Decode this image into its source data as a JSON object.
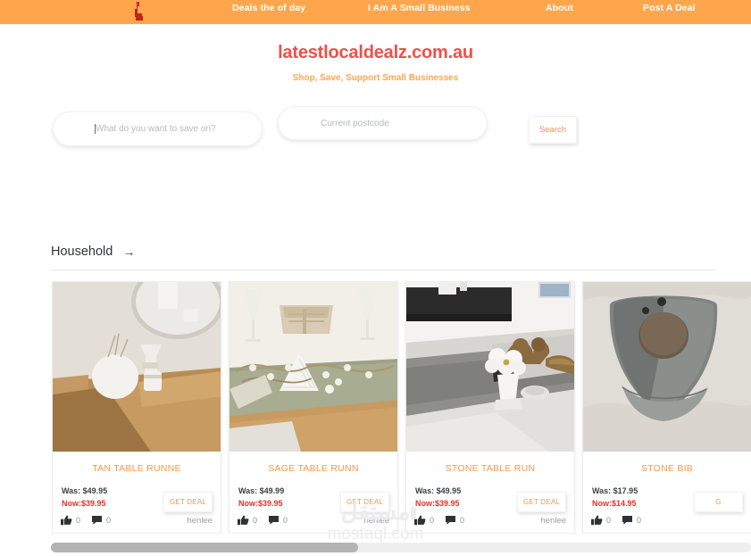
{
  "colors": {
    "header_bg": "#ffa64d",
    "brand_red": "#ef4f4a",
    "accent_orange": "#ffa64d",
    "price_now_red": "#ef2d2d",
    "card_title": "#f99746",
    "button_text": "#f98a5c"
  },
  "nav": {
    "logo_name": "latestlocaldealz-logo-icon",
    "items": [
      {
        "label": "Deals the of day"
      },
      {
        "label": "I Am A Small Business"
      },
      {
        "label": "About"
      },
      {
        "label": "Post A Deal"
      }
    ]
  },
  "brand": {
    "title": "latestlocaldealz.com.au",
    "tagline": "Shop, Save, Support Small Businesses"
  },
  "search": {
    "keyword_value": "",
    "keyword_placeholder": "What do you want to save on?",
    "postcode_value": "",
    "postcode_placeholder": "Current postcode",
    "button_label": "Search"
  },
  "section": {
    "title": "Household",
    "arrow_glyph": "→"
  },
  "products": [
    {
      "title": "TAN TABLE RUNNE",
      "was_label": "Was: $49.95",
      "now_label": "Now:$39.95",
      "deal_label": "GET DEAL",
      "likes": "0",
      "comments": "0",
      "vendor": "henlee",
      "image_name": "tan-table-runner-photo"
    },
    {
      "title": "SAGE TABLE RUNN",
      "was_label": "Was: $49.99",
      "now_label": "Now:$39.95",
      "deal_label": "GET DEAL",
      "likes": "0",
      "comments": "0",
      "vendor": "henlee",
      "image_name": "sage-table-runner-photo"
    },
    {
      "title": "STONE TABLE RUN",
      "was_label": "Was: $49.95",
      "now_label": "Now:$39.95",
      "deal_label": "GET DEAL",
      "likes": "0",
      "comments": "0",
      "vendor": "henlee",
      "image_name": "stone-table-runner-photo"
    },
    {
      "title": "STONE BIB",
      "was_label": "Was: $17.95",
      "now_label": "Now:$14.95",
      "deal_label": "G",
      "likes": "0",
      "comments": "0",
      "vendor": "",
      "image_name": "stone-bib-photo"
    }
  ],
  "watermark": {
    "arabic": "مستقل",
    "latin": "mostaql.com"
  },
  "scroll": {
    "horizontal_position": "start"
  }
}
